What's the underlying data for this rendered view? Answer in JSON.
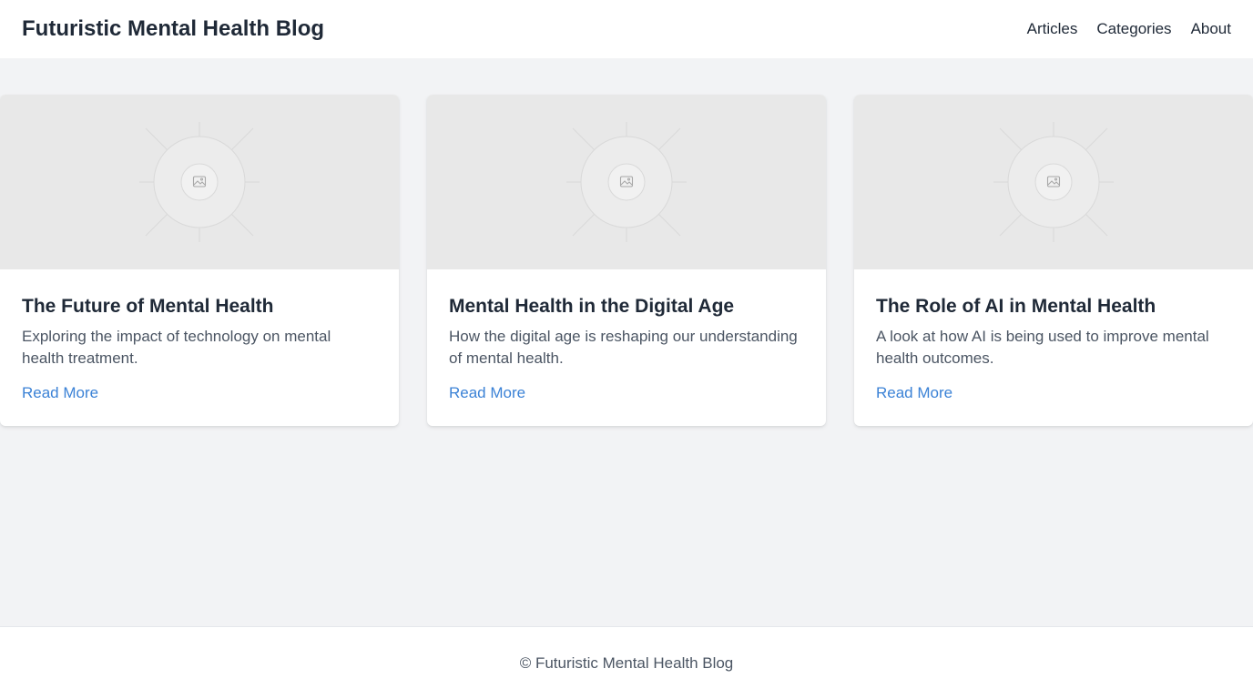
{
  "header": {
    "site_title": "Futuristic Mental Health Blog",
    "nav": [
      {
        "label": "Articles"
      },
      {
        "label": "Categories"
      },
      {
        "label": "About"
      }
    ]
  },
  "articles": [
    {
      "title": "The Future of Mental Health",
      "description": "Exploring the impact of technology on mental health treatment.",
      "link_label": "Read More",
      "image_icon": "image-placeholder-icon"
    },
    {
      "title": "Mental Health in the Digital Age",
      "description": "How the digital age is reshaping our understanding of mental health.",
      "link_label": "Read More",
      "image_icon": "image-placeholder-icon"
    },
    {
      "title": "The Role of AI in Mental Health",
      "description": "A look at how AI is being used to improve mental health outcomes.",
      "link_label": "Read More",
      "image_icon": "image-placeholder-icon"
    }
  ],
  "footer": {
    "text": "© Futuristic Mental Health Blog"
  },
  "colors": {
    "background": "#f2f3f5",
    "surface": "#ffffff",
    "text_primary": "#1f2937",
    "text_secondary": "#4b5563",
    "link": "#3b82d6",
    "placeholder": "#e8e8e8"
  }
}
